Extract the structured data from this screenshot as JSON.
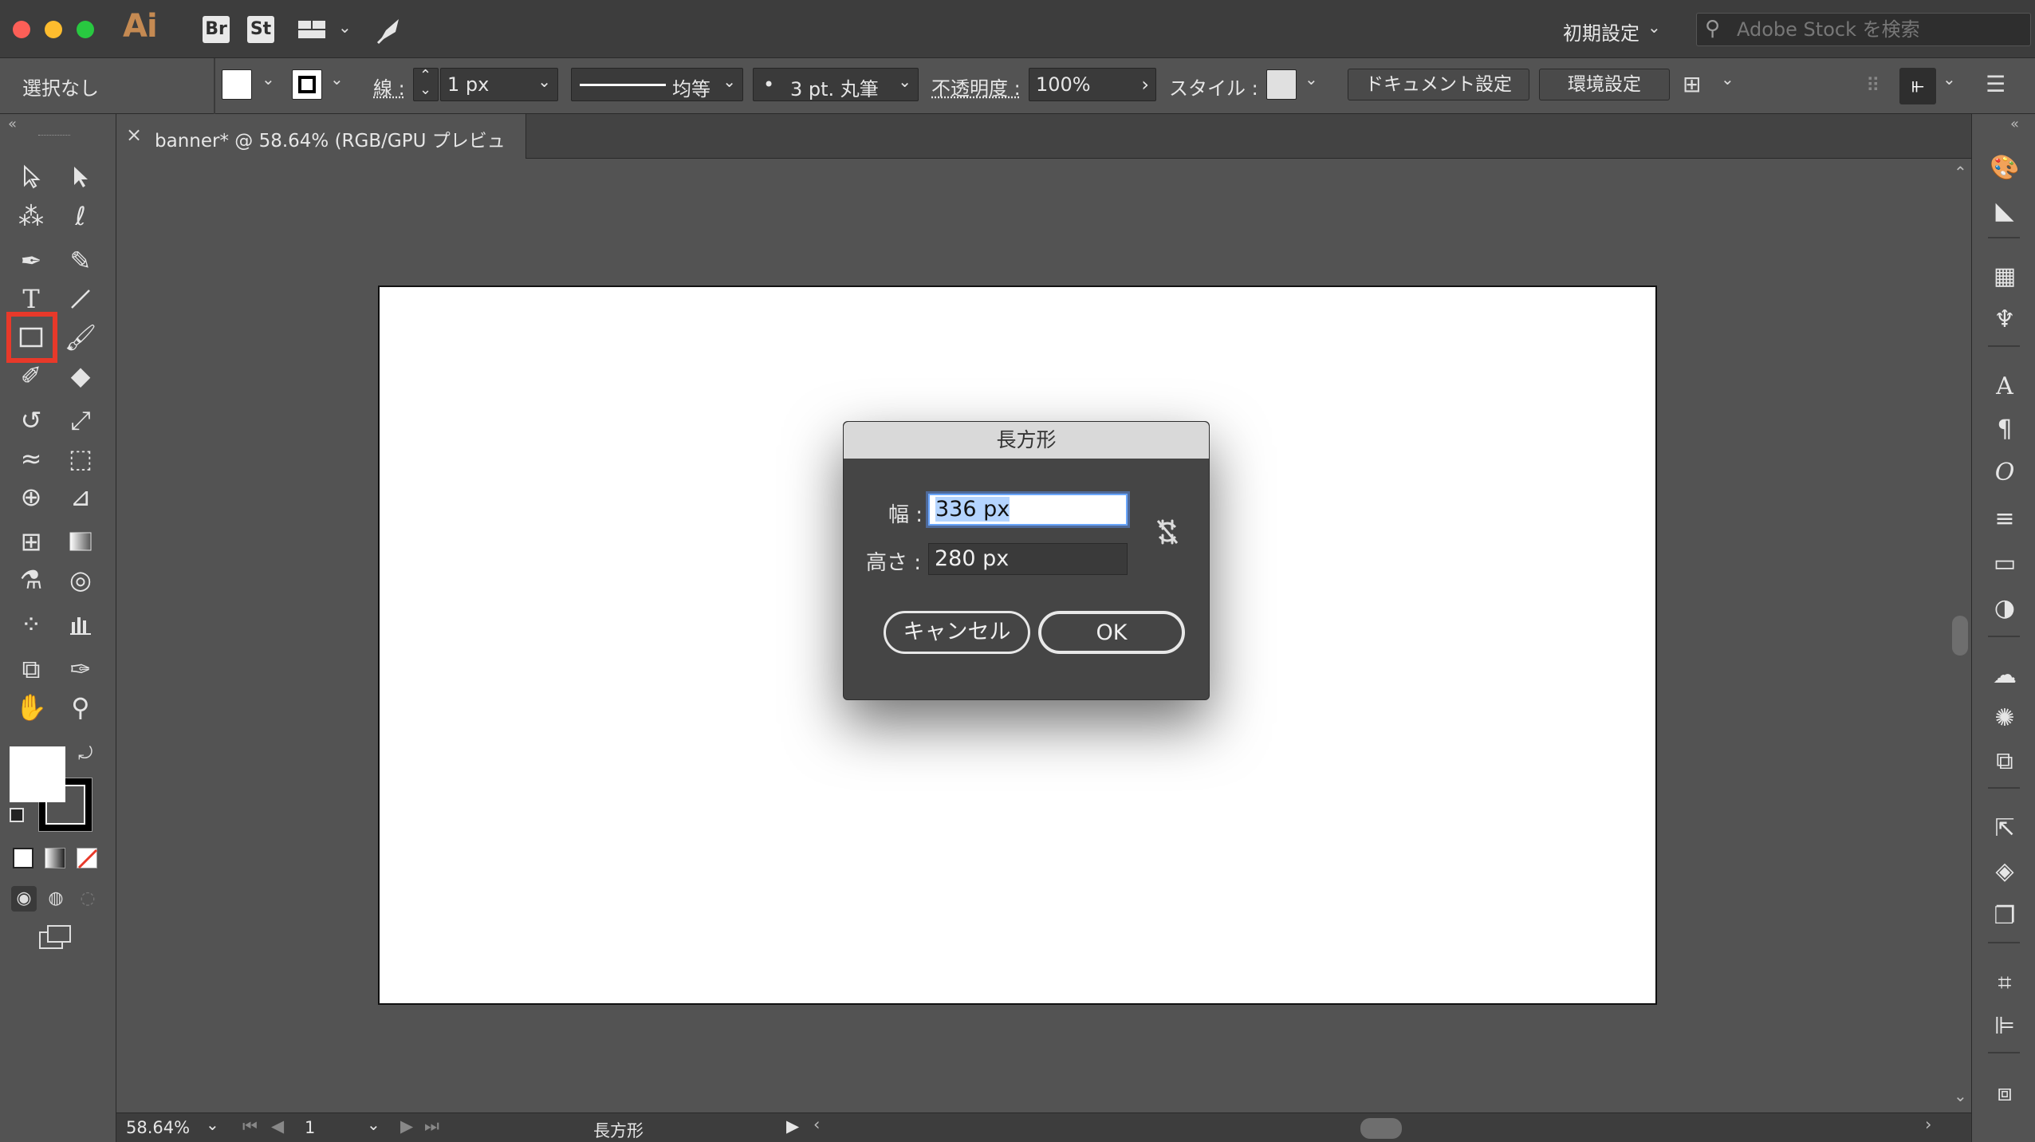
{
  "app": {
    "logo": "Ai",
    "bridge_badge": "Br",
    "stock_badge": "St",
    "workspace_label": "初期設定",
    "stock_search_placeholder": "Adobe Stock を検索"
  },
  "control_bar": {
    "selection_label": "選択なし",
    "stroke_label": "線 :",
    "stroke_weight": "1 px",
    "stroke_profile": "均等",
    "brush_label": "3 pt. 丸筆",
    "opacity_label": "不透明度 :",
    "opacity_value": "100%",
    "style_label": "スタイル :",
    "document_settings_button": "ドキュメント設定",
    "preferences_button": "環境設定"
  },
  "document_tab": {
    "close_glyph": "×",
    "title": "banner* @ 58.64% (RGB/GPU プレビュー)"
  },
  "dialog": {
    "title": "長方形",
    "width_label": "幅 :",
    "width_value": "336 px",
    "height_label": "高さ :",
    "height_value": "280 px",
    "cancel_button": "キャンセル",
    "ok_button": "OK"
  },
  "status_bar": {
    "zoom": "58.64%",
    "artboard_number": "1",
    "current_tool": "長方形"
  },
  "colors": {
    "ui_background": "#535353",
    "title_bar": "#3d3d3d",
    "highlight_red": "#e8392a",
    "selection_blue": "#6aa6ff",
    "illustrator_orange": "#c58a52"
  }
}
